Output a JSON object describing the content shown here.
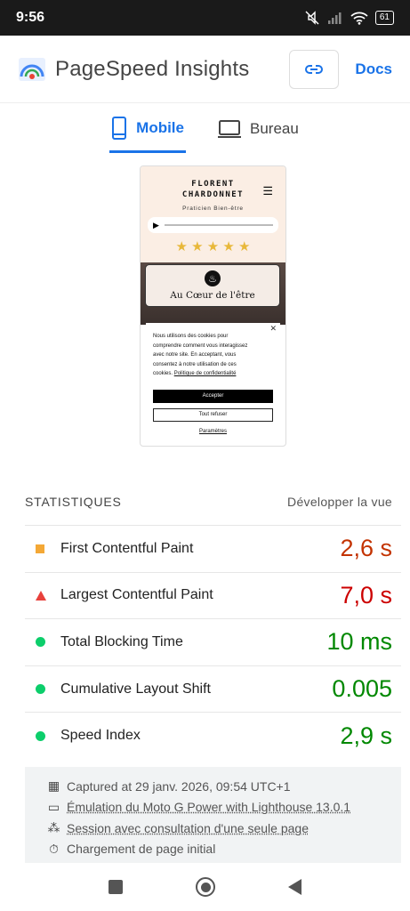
{
  "status": {
    "time": "9:56",
    "battery": "61"
  },
  "header": {
    "title": "PageSpeed Insights",
    "docs_label": "Docs"
  },
  "tabs": [
    {
      "label": "Mobile",
      "active": true
    },
    {
      "label": "Bureau",
      "active": false
    }
  ],
  "preview": {
    "name_line1": "FLORENT",
    "name_line2": "CHARDONNET",
    "subtitle": "Praticien Bien-être",
    "stars": "★ ★ ★ ★ ★",
    "card_title": "Au Cœur de l'être",
    "cookie_text": "Nous utilisons des cookies pour comprendre comment vous interagissez avec notre site. En acceptant, vous consentez à notre utilisation de ces cookies.",
    "cookie_link": "Politique de confidentialité",
    "accept": "Accepter",
    "refuse": "Tout refuser",
    "params": "Paramètres"
  },
  "stats": {
    "heading": "STATISTIQUES",
    "expand_label": "Développer la vue",
    "metrics": [
      {
        "name": "First Contentful Paint",
        "value": "2,6 s",
        "rating": "average",
        "color": "#c33300"
      },
      {
        "name": "Largest Contentful Paint",
        "value": "7,0 s",
        "rating": "fail",
        "color": "#cc0000"
      },
      {
        "name": "Total Blocking Time",
        "value": "10 ms",
        "rating": "pass",
        "color": "#008800"
      },
      {
        "name": "Cumulative Layout Shift",
        "value": "0.005",
        "rating": "pass",
        "color": "#008800"
      },
      {
        "name": "Speed Index",
        "value": "2,9 s",
        "rating": "pass",
        "color": "#008800"
      }
    ]
  },
  "info": {
    "captured": "Captured at 29 janv. 2026, 09:54 UTC+1",
    "emulation": "Émulation du Moto G Power with Lighthouse 13.0.1",
    "session": "Session avec consultation d'une seule page",
    "load": "Chargement de page initial"
  }
}
